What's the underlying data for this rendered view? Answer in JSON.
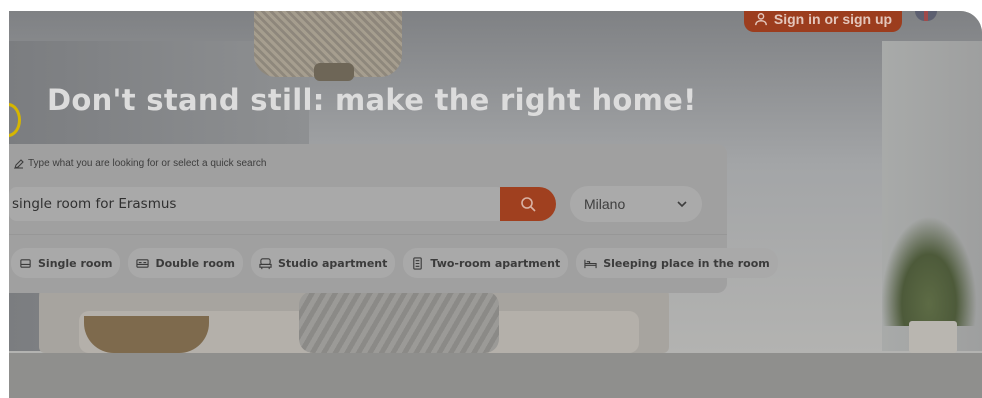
{
  "header": {
    "signin_label": "Sign in or sign up",
    "signin_icon": "user-icon",
    "language_icon": "uk-flag-icon"
  },
  "hero": {
    "headline": "Don't stand still: make the right home!"
  },
  "search": {
    "hint": "Type what you are looking for or select a quick search",
    "hint_icon": "pencil-icon",
    "value": "single room for Erasmus",
    "button_icon": "search-icon",
    "city": "Milano",
    "city_icon": "chevron-down-icon"
  },
  "quick_search": [
    {
      "label": "Single room",
      "icon": "single-bed-icon"
    },
    {
      "label": "Double room",
      "icon": "double-bed-icon"
    },
    {
      "label": "Studio apartment",
      "icon": "sofa-icon"
    },
    {
      "label": "Two-room apartment",
      "icon": "building-icon"
    },
    {
      "label": "Sleeping place in the room",
      "icon": "bed-icon"
    }
  ],
  "colors": {
    "accent": "#a0401f",
    "overlay_text": "#dcdcdc"
  }
}
